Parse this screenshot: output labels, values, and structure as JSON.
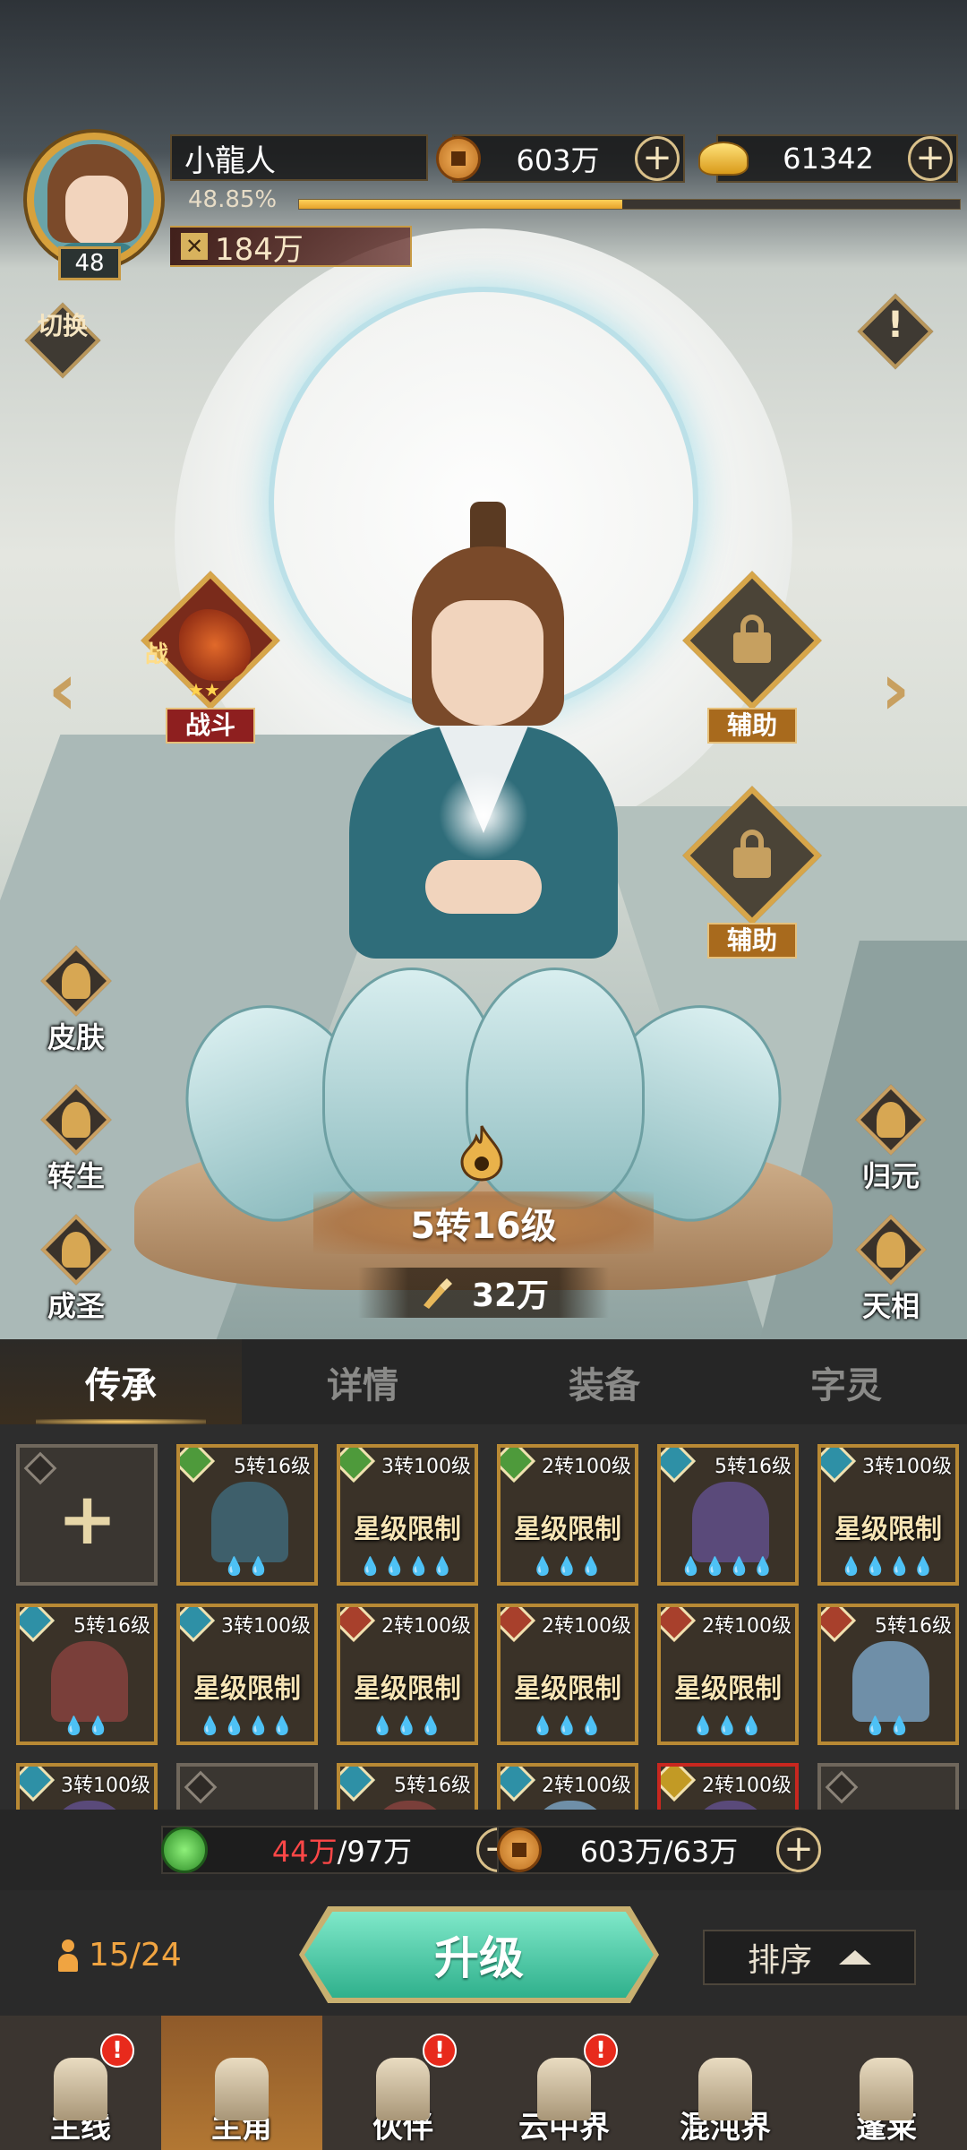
{
  "player": {
    "name": "小龍人",
    "level": "48",
    "exp_percent": "48.85%",
    "exp_fraction": 0.4885,
    "power": "184万"
  },
  "currency": {
    "copper": "603万",
    "gold": "61342"
  },
  "buttons": {
    "switch": "切换",
    "alert": "!"
  },
  "slots": {
    "battle": {
      "tag": "战斗",
      "badge": "战"
    },
    "assist1": {
      "tag": "辅助"
    },
    "assist2": {
      "tag": "辅助"
    }
  },
  "side_buttons": {
    "skin": "皮肤",
    "rebirth": "转生",
    "saint": "成圣",
    "guiyuan": "归元",
    "tianxiang": "天相"
  },
  "hero": {
    "level_text": "5转16级",
    "power": "32万"
  },
  "tabs": [
    "传承",
    "详情",
    "装备",
    "字灵"
  ],
  "grid": {
    "limit_text": "星级限制",
    "cards": [
      {
        "rank": "",
        "type": "empty"
      },
      {
        "rank": "5转16级",
        "elem": "g",
        "type": "portrait",
        "drops": "💧💧",
        "dropcolor": "gold"
      },
      {
        "rank": "3转100级",
        "elem": "g",
        "type": "limit",
        "drops": "💧💧💧💧"
      },
      {
        "rank": "2转100级",
        "elem": "g",
        "type": "limit",
        "drops": "💧💧💧"
      },
      {
        "rank": "5转16级",
        "elem": "b",
        "type": "portrait",
        "drops": "💧💧💧💧",
        "dropcolor": "gold"
      },
      {
        "rank": "3转100级",
        "elem": "b",
        "type": "limit",
        "drops": "💧💧💧💧"
      },
      {
        "rank": "5转16级",
        "elem": "b",
        "type": "portrait",
        "drops": "💧💧",
        "dropcolor": "gold"
      },
      {
        "rank": "3转100级",
        "elem": "b",
        "type": "limit",
        "drops": "💧💧💧💧"
      },
      {
        "rank": "2转100级",
        "elem": "r",
        "type": "limit",
        "drops": "💧💧💧"
      },
      {
        "rank": "2转100级",
        "elem": "r",
        "type": "limit",
        "drops": "💧💧💧"
      },
      {
        "rank": "2转100级",
        "elem": "r",
        "type": "limit",
        "drops": "💧💧💧"
      },
      {
        "rank": "5转16级",
        "elem": "r",
        "type": "portrait",
        "drops": "💧💧",
        "dropcolor": "gold"
      },
      {
        "rank": "3转100级",
        "elem": "b",
        "type": "partial"
      },
      {
        "rank": "",
        "type": "emptypartial"
      },
      {
        "rank": "5转16级",
        "elem": "b",
        "type": "partial"
      },
      {
        "rank": "2转100级",
        "elem": "b",
        "type": "partial"
      },
      {
        "rank": "2转100级",
        "elem": "y",
        "type": "partial",
        "red": true
      },
      {
        "rank": "",
        "type": "emptypartial"
      }
    ]
  },
  "resources": {
    "green_have": "44万",
    "green_need": "/97万",
    "copper": "603万/63万"
  },
  "actions": {
    "count": "15/24",
    "upgrade": "升级",
    "sort": "排序"
  },
  "nav": [
    {
      "label": "主线",
      "badge": "!"
    },
    {
      "label": "主角",
      "badge": ""
    },
    {
      "label": "伙伴",
      "badge": "!"
    },
    {
      "label": "云中界",
      "badge": "!"
    },
    {
      "label": "混沌界",
      "badge": ""
    },
    {
      "label": "蓬莱",
      "badge": ""
    }
  ]
}
